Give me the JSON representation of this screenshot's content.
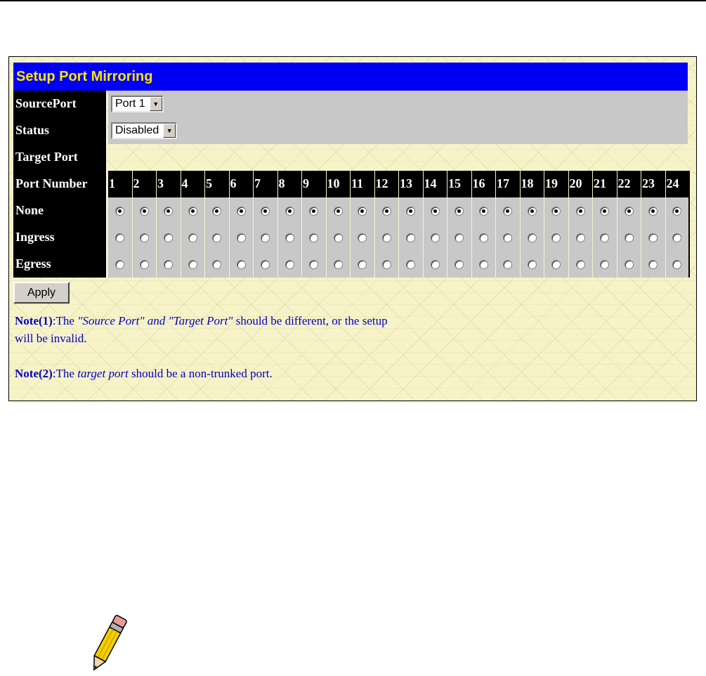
{
  "title": "Setup Port Mirroring",
  "source_port": {
    "label": "SourcePort",
    "selected": "Port 1"
  },
  "status": {
    "label": "Status",
    "selected": "Disabled"
  },
  "target_port": {
    "label": "Target Port"
  },
  "port_number_label": "Port Number",
  "ports": [
    "1",
    "2",
    "3",
    "4",
    "5",
    "6",
    "7",
    "8",
    "9",
    "10",
    "11",
    "12",
    "13",
    "14",
    "15",
    "16",
    "17",
    "18",
    "19",
    "20",
    "21",
    "22",
    "23",
    "24"
  ],
  "modes": [
    {
      "label": "None",
      "selected": true
    },
    {
      "label": "Ingress",
      "selected": false
    },
    {
      "label": "Egress",
      "selected": false
    }
  ],
  "apply_label": "Apply",
  "note1": {
    "prefix": "Note(1)",
    "pre": ":The ",
    "em": "\"Source Port\" and \"Target Port\"",
    "post_line1": " should be different, or the setup",
    "line2": "will be invalid."
  },
  "note2": {
    "prefix": "Note(2)",
    "pre": ":The ",
    "em": "target port",
    "post": " should be a non-trunked port."
  },
  "colors": {
    "title_bg": "#0000f5",
    "title_text": "#ffe600",
    "panel_bg": "#f7f3c8",
    "note_text": "#0000c8"
  },
  "icons": [
    "chevron-down-icon",
    "pencil-note-icon"
  ]
}
